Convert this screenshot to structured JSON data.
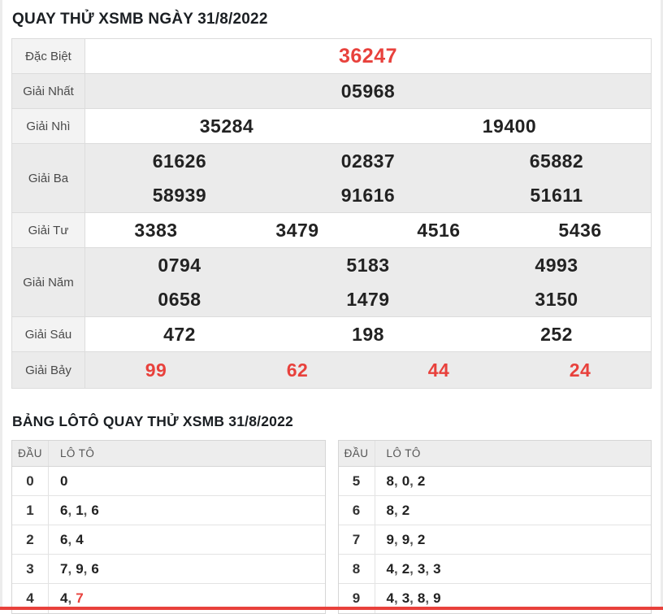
{
  "header": {
    "title": "QUAY THỬ XSMB NGÀY 31/8/2022"
  },
  "colors": {
    "accent_red": "#e8413c",
    "number_dark": "#222222",
    "stripe_gray": "#ebebeb",
    "label_gray": "#f3f3f3"
  },
  "results": {
    "rows": [
      {
        "label": "Đặc Biệt",
        "red": true,
        "large": true,
        "striped": false,
        "lines": [
          [
            "36247"
          ]
        ]
      },
      {
        "label": "Giải Nhất",
        "red": false,
        "large": false,
        "striped": true,
        "lines": [
          [
            "05968"
          ]
        ]
      },
      {
        "label": "Giải Nhì",
        "red": false,
        "large": false,
        "striped": false,
        "lines": [
          [
            "35284",
            "19400"
          ]
        ]
      },
      {
        "label": "Giải Ba",
        "red": false,
        "large": false,
        "striped": true,
        "lines": [
          [
            "61626",
            "02837",
            "65882"
          ],
          [
            "58939",
            "91616",
            "51611"
          ]
        ]
      },
      {
        "label": "Giải Tư",
        "red": false,
        "large": false,
        "striped": false,
        "lines": [
          [
            "3383",
            "3479",
            "4516",
            "5436"
          ]
        ]
      },
      {
        "label": "Giải Năm",
        "red": false,
        "large": false,
        "striped": true,
        "lines": [
          [
            "0794",
            "5183",
            "4993"
          ],
          [
            "0658",
            "1479",
            "3150"
          ]
        ]
      },
      {
        "label": "Giải Sáu",
        "red": false,
        "large": false,
        "striped": false,
        "lines": [
          [
            "472",
            "198",
            "252"
          ]
        ]
      },
      {
        "label": "Giải Bảy",
        "red": true,
        "large": false,
        "striped": true,
        "lines": [
          [
            "99",
            "62",
            "44",
            "24"
          ]
        ]
      }
    ]
  },
  "loto": {
    "title": "BẢNG LÔTÔ QUAY THỬ XSMB 31/8/2022",
    "col_headers": [
      "ĐẦU",
      "LÔ TÔ"
    ],
    "left_rows": [
      {
        "head": "0",
        "values": [
          {
            "n": "0",
            "red": false
          }
        ]
      },
      {
        "head": "1",
        "values": [
          {
            "n": "6",
            "red": false
          },
          {
            "n": "1",
            "red": false
          },
          {
            "n": "6",
            "red": false
          }
        ]
      },
      {
        "head": "2",
        "values": [
          {
            "n": "6",
            "red": false
          },
          {
            "n": "4",
            "red": false
          }
        ]
      },
      {
        "head": "3",
        "values": [
          {
            "n": "7",
            "red": false
          },
          {
            "n": "9",
            "red": false
          },
          {
            "n": "6",
            "red": false
          }
        ]
      },
      {
        "head": "4",
        "values": [
          {
            "n": "4",
            "red": false
          },
          {
            "n": "7",
            "red": true
          }
        ]
      }
    ],
    "right_rows": [
      {
        "head": "5",
        "values": [
          {
            "n": "8",
            "red": false
          },
          {
            "n": "0",
            "red": false
          },
          {
            "n": "2",
            "red": false
          }
        ]
      },
      {
        "head": "6",
        "values": [
          {
            "n": "8",
            "red": false
          },
          {
            "n": "2",
            "red": false
          }
        ]
      },
      {
        "head": "7",
        "values": [
          {
            "n": "9",
            "red": false
          },
          {
            "n": "9",
            "red": false
          },
          {
            "n": "2",
            "red": false
          }
        ]
      },
      {
        "head": "8",
        "values": [
          {
            "n": "4",
            "red": false
          },
          {
            "n": "2",
            "red": false
          },
          {
            "n": "3",
            "red": false
          },
          {
            "n": "3",
            "red": false
          }
        ]
      },
      {
        "head": "9",
        "values": [
          {
            "n": "4",
            "red": false
          },
          {
            "n": "3",
            "red": false
          },
          {
            "n": "8",
            "red": false
          },
          {
            "n": "9",
            "red": false
          }
        ]
      }
    ]
  },
  "footer": {
    "red_bar": true
  }
}
